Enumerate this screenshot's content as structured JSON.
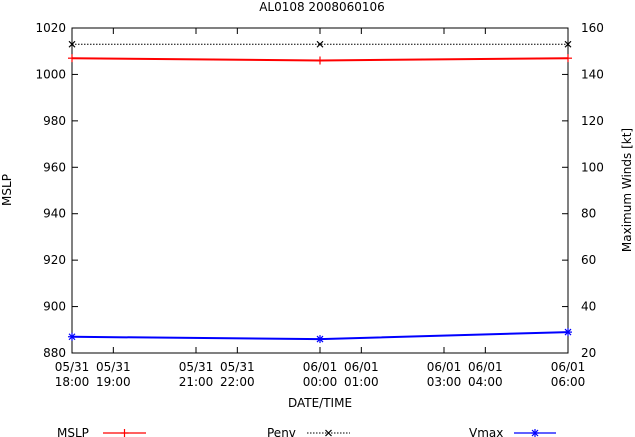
{
  "chart_data": {
    "type": "line",
    "title": "AL0108 2008060106",
    "xlabel": "DATE/TIME",
    "ylabel": "MSLP",
    "y2label": "Maximum Winds [kt]",
    "ylim": [
      880,
      1020
    ],
    "y2lim": [
      20,
      160
    ],
    "xlim": [
      "2008-05-31 18:00",
      "2008-06-01 06:00"
    ],
    "yticks": [
      880,
      900,
      920,
      940,
      960,
      980,
      1000,
      1020
    ],
    "y2ticks": [
      20,
      40,
      60,
      80,
      100,
      120,
      140,
      160
    ],
    "xticks": [
      {
        "t": "2008-05-31 18:00",
        "line1": "05/31",
        "line2": "18:00"
      },
      {
        "t": "2008-05-31 19:00",
        "line1": "05/31",
        "line2": "19:00"
      },
      {
        "t": "2008-05-31 21:00",
        "line1": "05/31",
        "line2": "21:00"
      },
      {
        "t": "2008-05-31 22:00",
        "line1": "05/31",
        "line2": "22:00"
      },
      {
        "t": "2008-06-01 00:00",
        "line1": "06/01",
        "line2": "00:00"
      },
      {
        "t": "2008-06-01 01:00",
        "line1": "06/01",
        "line2": "01:00"
      },
      {
        "t": "2008-06-01 03:00",
        "line1": "06/01",
        "line2": "03:00"
      },
      {
        "t": "2008-06-01 04:00",
        "line1": "06/01",
        "line2": "04:00"
      },
      {
        "t": "2008-06-01 06:00",
        "line1": "06/01",
        "line2": "06:00"
      }
    ],
    "grid": false,
    "legend_position": "bottom",
    "series": [
      {
        "name": "MSLP",
        "axis": "left",
        "color": "#ff0000",
        "marker": "plus",
        "x": [
          "2008-05-31 18:00",
          "2008-06-01 00:00",
          "2008-06-01 06:00"
        ],
        "y": [
          1007,
          1006,
          1007
        ]
      },
      {
        "name": "Penv",
        "axis": "left",
        "color": "#000000",
        "marker": "cross",
        "dash": "dotted",
        "x": [
          "2008-05-31 18:00",
          "2008-06-01 00:00",
          "2008-06-01 06:00"
        ],
        "y": [
          1013,
          1013,
          1013
        ]
      },
      {
        "name": "Vmax",
        "axis": "right",
        "color": "#0000ff",
        "marker": "star",
        "x": [
          "2008-05-31 18:00",
          "2008-06-01 00:00",
          "2008-06-01 06:00"
        ],
        "y": [
          27,
          26,
          29
        ]
      }
    ]
  }
}
